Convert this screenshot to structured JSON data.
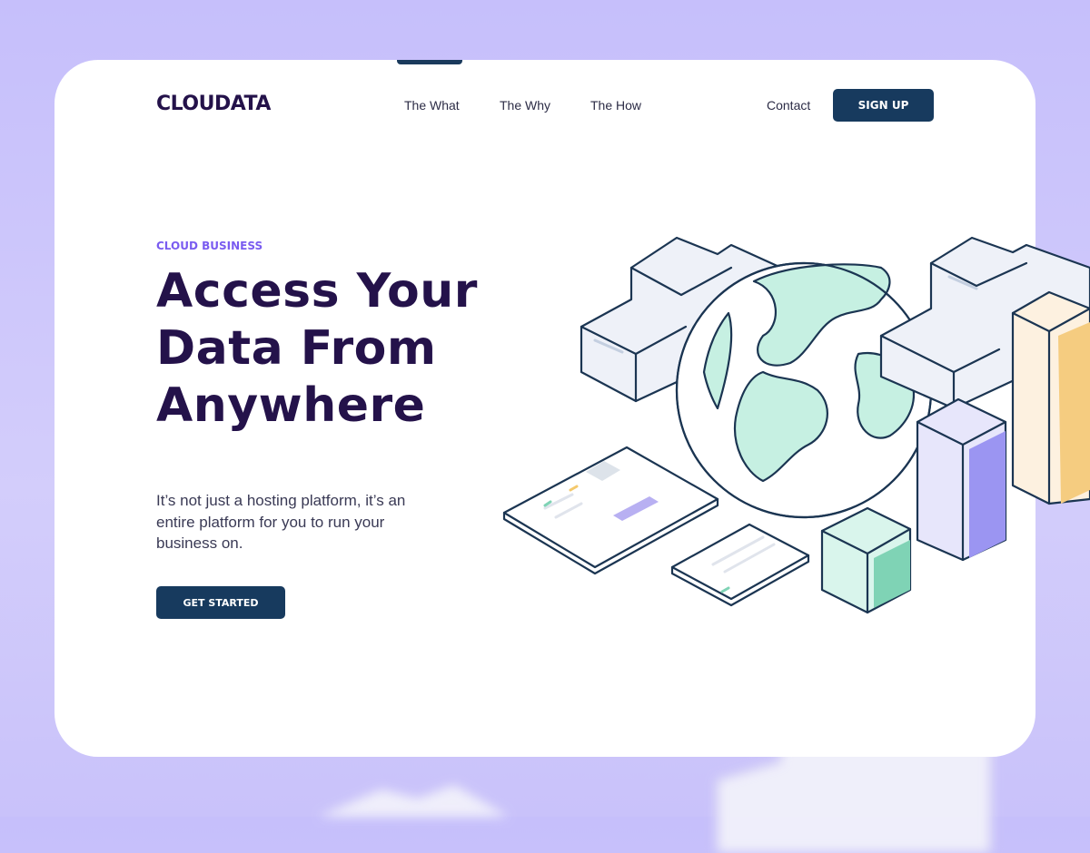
{
  "brand": {
    "logo_text": "CLOUDATA"
  },
  "nav": {
    "items": [
      {
        "label": "The What"
      },
      {
        "label": "The Why"
      },
      {
        "label": "The How"
      }
    ],
    "contact_label": "Contact",
    "signup_label": "SIGN UP"
  },
  "hero": {
    "eyebrow": "CLOUD BUSINESS",
    "title_line1": "Access Your",
    "title_line2": "Data From",
    "title_line3": "Anywhere",
    "subtitle": "It’s not just a hosting platform, it’s an entire platform for you to run your business on.",
    "cta_label": "GET STARTED"
  },
  "illustration": {
    "icons": [
      "globe-icon",
      "cloud-icon",
      "server-box-icon",
      "tablet-icon",
      "phone-icon"
    ]
  },
  "colors": {
    "background": "#c6bffb",
    "brand_dark": "#24124a",
    "button": "#173a5e",
    "accent": "#7a5cf0",
    "mint": "#c6f0e2",
    "lavender": "#9b95f2",
    "peach": "#f5cc80"
  }
}
